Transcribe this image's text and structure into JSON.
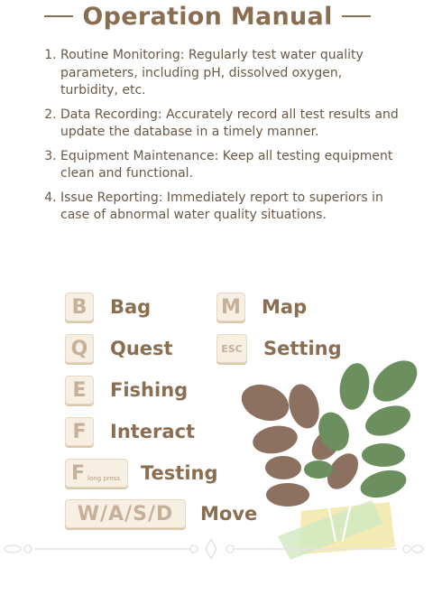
{
  "title": "Operation Manual",
  "manual": [
    "Routine Monitoring: Regularly test water quality parameters, including pH, dissolved oxygen, turbidity, etc.",
    "Data Recording: Accurately record all test results and update the database in a timely manner.",
    "Equipment Maintenance: Keep all testing equipment clean and functional.",
    "Issue Reporting: Immediately report to superiors in case of abnormal water quality situations."
  ],
  "keys": {
    "bag": {
      "key": "B",
      "label": "Bag"
    },
    "quest": {
      "key": "Q",
      "label": "Quest"
    },
    "fishing": {
      "key": "E",
      "label": "Fishing"
    },
    "interact": {
      "key": "F",
      "label": "Interact"
    },
    "testing": {
      "key": "F",
      "sub": "long press",
      "label": "Testing"
    },
    "move": {
      "key": "W/A/S/D",
      "label": "Move"
    },
    "map": {
      "key": "M",
      "label": "Map"
    },
    "setting": {
      "key": "ESC",
      "label": "Setting"
    }
  },
  "colors": {
    "title": "#8a6e52",
    "text": "#6a5846",
    "keycap_bg": "#f7efe2",
    "keycap_text": "#c6b09a",
    "leaf_brown": "#8c7060",
    "leaf_green": "#6b8f5e"
  }
}
